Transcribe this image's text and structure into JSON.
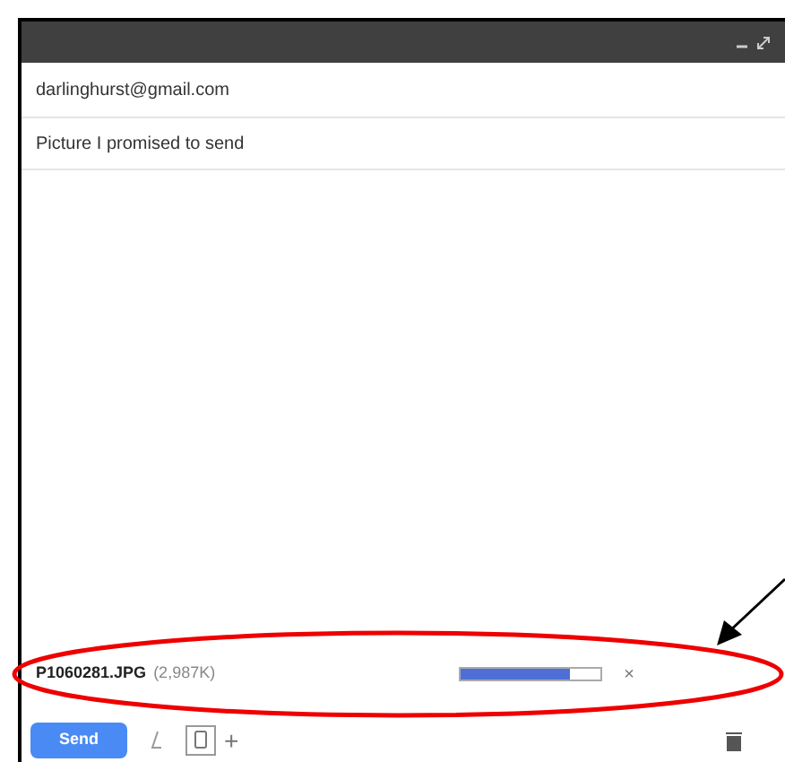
{
  "compose": {
    "to": "darlinghurst@gmail.com",
    "subject": "Picture I promised to send"
  },
  "attachment": {
    "name": "P1060281.JPG",
    "size": "(2,987K)",
    "level": 0.78,
    "remove": "×"
  },
  "toolbar": {
    "send": "Send",
    "more": "+"
  }
}
